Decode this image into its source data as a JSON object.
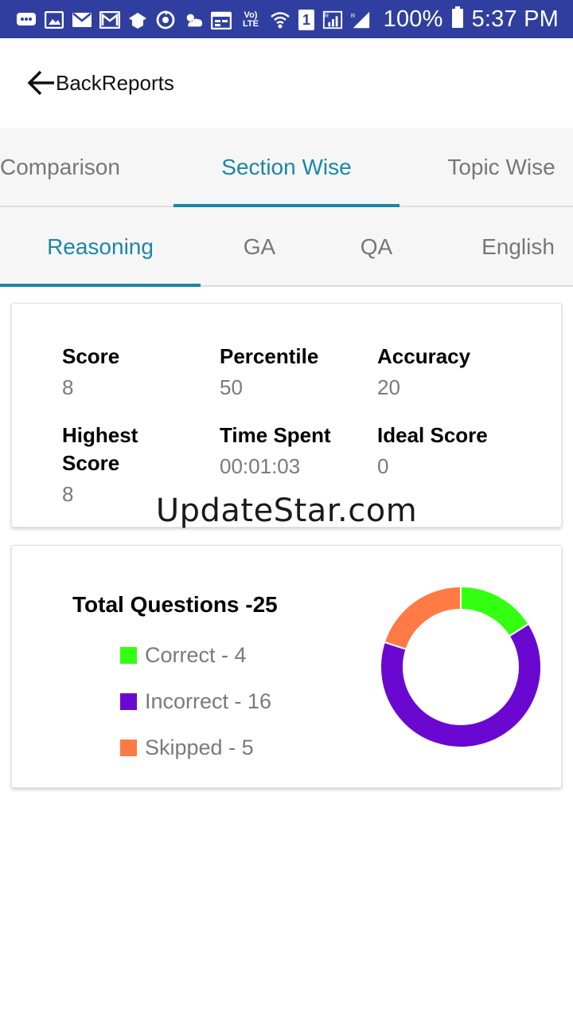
{
  "status_bar": {
    "battery": "100%",
    "time": "5:37 PM",
    "sim_badge": "1",
    "volte": "Vo) LTE",
    "icons": [
      "chat-icon",
      "image-icon",
      "mail-icon",
      "gmail-icon",
      "school-icon",
      "sync-icon",
      "weather-icon",
      "calendar-icon",
      "volte-icon",
      "wifi-icon",
      "sim-icon",
      "signal-icon",
      "signal-icon",
      "battery-icon"
    ]
  },
  "header": {
    "back_icon": "arrow-left-icon",
    "title": "BackReports"
  },
  "tabs_primary": [
    {
      "label": "Comparison",
      "active": false
    },
    {
      "label": "Section Wise",
      "active": true
    },
    {
      "label": "Topic Wise",
      "active": false
    }
  ],
  "tabs_sections": [
    {
      "label": "Reasoning",
      "active": true
    },
    {
      "label": "GA",
      "active": false
    },
    {
      "label": "QA",
      "active": false
    },
    {
      "label": "English",
      "active": false
    }
  ],
  "stats": [
    {
      "label": "Score",
      "value": "8"
    },
    {
      "label": "Percentile",
      "value": "50"
    },
    {
      "label": "Accuracy",
      "value": "20"
    },
    {
      "label": "Highest Score",
      "value": "8"
    },
    {
      "label": "Time Spent",
      "value": "00:01:03"
    },
    {
      "label": "Ideal Score",
      "value": "0"
    }
  ],
  "watermark": "UpdateStar.com",
  "summary": {
    "total_label": "Total Questions -25",
    "legend": [
      {
        "label": "Correct - 4",
        "color": "#33ff11"
      },
      {
        "label": "Incorrect - 16",
        "color": "#6a08d2"
      },
      {
        "label": "Skipped - 5",
        "color": "#ff7a45"
      }
    ]
  },
  "chart_data": {
    "type": "pie",
    "categories": [
      "Correct",
      "Incorrect",
      "Skipped"
    ],
    "values": [
      4,
      16,
      5
    ],
    "colors": [
      "#33ff11",
      "#6a08d2",
      "#ff7a45"
    ],
    "donut": true,
    "legend": "left"
  }
}
